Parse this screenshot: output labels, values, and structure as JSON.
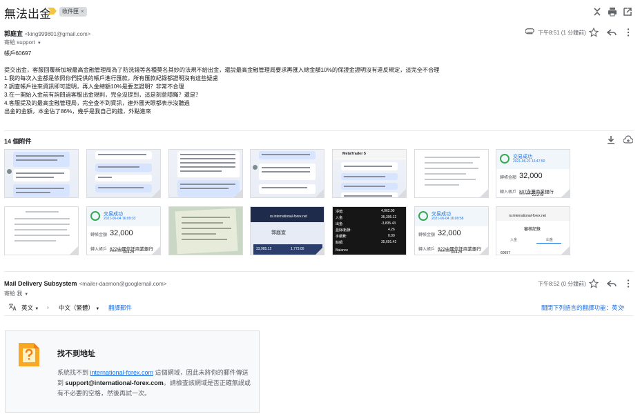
{
  "subject": "無法出金",
  "label": "收件匣",
  "label_close": "×",
  "message1": {
    "sender_name": "郭庭宜",
    "sender_email": "<king999801@gmail.com>",
    "to": "寄給 support",
    "time": "下午8:51 (1 分鐘前)",
    "body": [
      "帳戶60697",
      "",
      "提交出金，客服回覆新加坡最高金融管理局為了防洗錢等各種莫名其妙的法規不給出金，還說最高金融管理局要求再匯入總金額10%的保證金證明沒有違反規定，這完全不合理",
      "1.我的每次入金都是依照你們提供的帳戶進行匯款，所有匯款紀錄都證明沒有這些疑慮",
      "2.調查帳戶往來資訊即可證明，再入金總額10%是要怎證明？非常不合理",
      "3.在一開始入金前有詢問過客服出金規則，完全沒提到，這是刻意隱瞞？還是？",
      "4.客服提及的最高金融管理局，完全查不到資訊，連外匯天眼都表示沒聽過",
      "出金的金額，本金佔了86%，幾乎是我自己的錢，外點進來"
    ],
    "attachments_count": "14 個附件"
  },
  "thumbs": {
    "bank": {
      "ok": "交易成功",
      "date1": "2021-06-04 16:09:33",
      "date2": "2021-06-04 16:09:58",
      "date3": "2021-06-21 16:47:50",
      "amount_label": "轉帳金額",
      "amount": "32,000",
      "to_label": "轉入帳戶",
      "bank1": "822中國信託商業銀行",
      "bank2": "807永豐商業銀行",
      "acct1": "********30425",
      "acct2": "********22375"
    },
    "mt": {
      "title": "MetaTrader 5"
    },
    "site": {
      "url": "rs.international-forex.net",
      "name": "郭庭宜",
      "v1": "33,985.12",
      "v2": "1,773.00"
    },
    "site2": {
      "url": "rs.international-forex.net",
      "title": "審核記錄",
      "tab1": "入金",
      "tab2": "出金",
      "row": "60697"
    },
    "dark": {
      "labels": [
        "淨值:",
        "入金:",
        "出金:",
        "盈餘/虧損:",
        "手續費:",
        "餘額:"
      ],
      "values": [
        "4,062.00",
        "35,305.12",
        "-3,835.43",
        "4.26",
        "0.00",
        "35,691.42"
      ],
      "balance": "Balance"
    }
  },
  "message2": {
    "sender_name": "Mail Delivery Subsystem",
    "sender_email": "<mailer-daemon@googlemail.com>",
    "to": "寄給 我",
    "time": "下午8:52 (0 分鐘前)"
  },
  "translate": {
    "from": "英文",
    "to": "中文（繁體）",
    "link": "翻譯郵件",
    "right": "關閉下列語言的翻譯功能：英文",
    "close": "×"
  },
  "bounce": {
    "title": "找不到地址",
    "text_pre": "系統找不到 ",
    "domain": "international-forex.com",
    "text_mid": " 這個網域，因此未將你的郵件傳送到 ",
    "address": "support@international-forex.com",
    "text_post": "。請檢查該網域是否正確無誤或有不必要的空格，然後再試一次。"
  },
  "colors": {
    "link": "#1a73e8",
    "warn": "#f9a825",
    "text": "#202124",
    "muted": "#5f6368"
  }
}
